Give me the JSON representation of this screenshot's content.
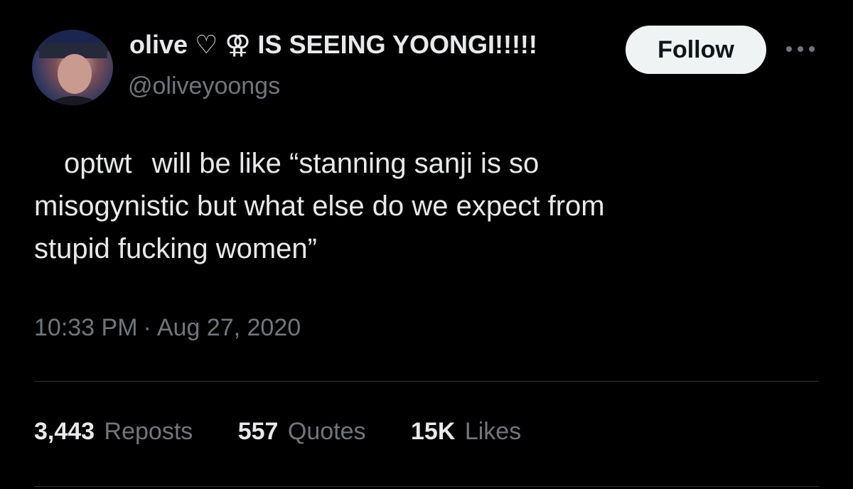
{
  "author": {
    "name_prefix": "olive",
    "heart_glyph": "♡",
    "symbol_glyph": "⚢",
    "name_suffix": "IS SEEING YOONGI!!!!!",
    "handle": "@oliveyoongs",
    "avatar_icon": "profile-photo"
  },
  "actions": {
    "follow_label": "Follow",
    "more_glyph": "•••"
  },
  "tweet": {
    "mention": "optwt",
    "line1": "will be like “stanning sanji is so",
    "line2": "misogynistic but what else do we expect from",
    "line3": "stupid fucking women”"
  },
  "meta": {
    "time": "10:33 PM",
    "separator": "·",
    "date": "Aug 27, 2020"
  },
  "stats": [
    {
      "count": "3,443",
      "label": "Reposts"
    },
    {
      "count": "557",
      "label": "Quotes"
    },
    {
      "count": "15K",
      "label": "Likes"
    }
  ],
  "colors": {
    "background": "#000000",
    "text": "#e7e9ea",
    "secondary": "#71767b",
    "divider": "#2f3336",
    "button_bg": "#eff3f4"
  }
}
